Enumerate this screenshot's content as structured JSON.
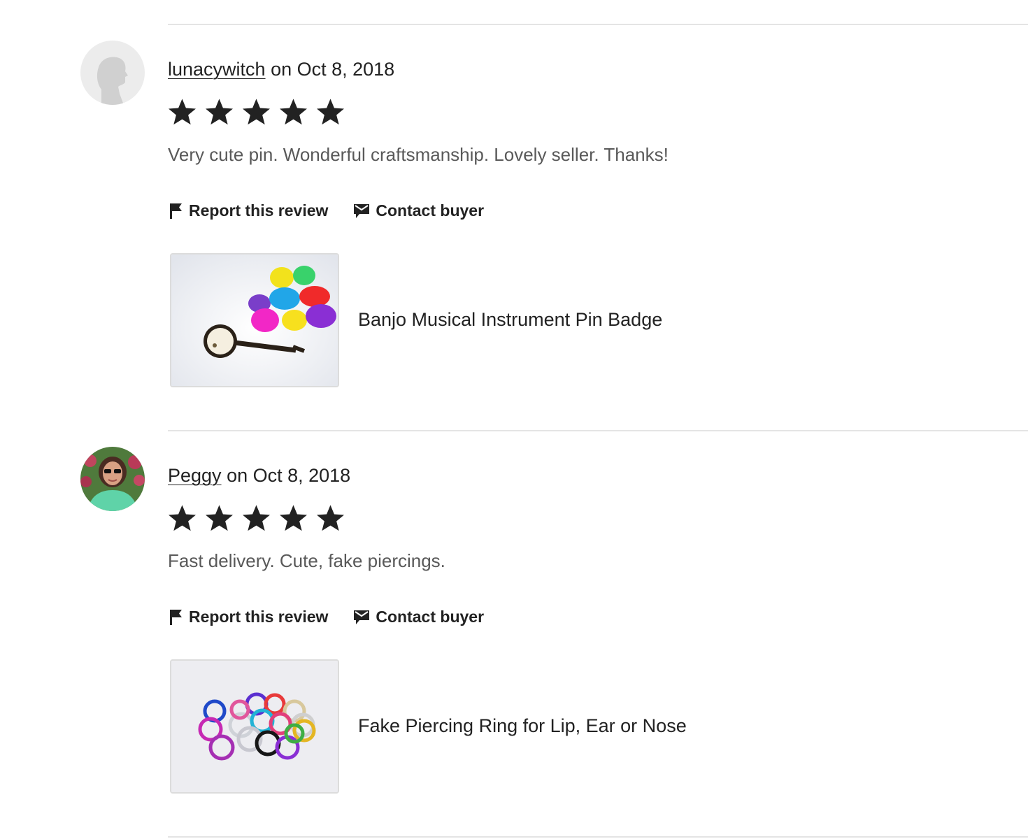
{
  "reviews": [
    {
      "reviewer": "lunacywitch",
      "date_text": "on Oct 8, 2018",
      "rating": 5,
      "text": "Very cute pin. Wonderful craftsmanship. Lovely seller. Thanks!",
      "report_label": "Report this review",
      "contact_label": "Contact buyer",
      "product_title": "Banjo Musical Instrument Pin Badge"
    },
    {
      "reviewer": "Peggy",
      "date_text": "on Oct 8, 2018",
      "rating": 5,
      "text": "Fast delivery. Cute, fake piercings.",
      "report_label": "Report this review",
      "contact_label": "Contact buyer",
      "product_title": "Fake Piercing Ring for Lip, Ear or Nose"
    }
  ],
  "icons": {
    "star": "star-icon",
    "report": "flag-icon",
    "contact": "message-icon",
    "default_avatar": "default-avatar-silhouette"
  },
  "colors": {
    "star": "#222222",
    "review_text": "#595959",
    "divider": "#e4e4e4"
  }
}
